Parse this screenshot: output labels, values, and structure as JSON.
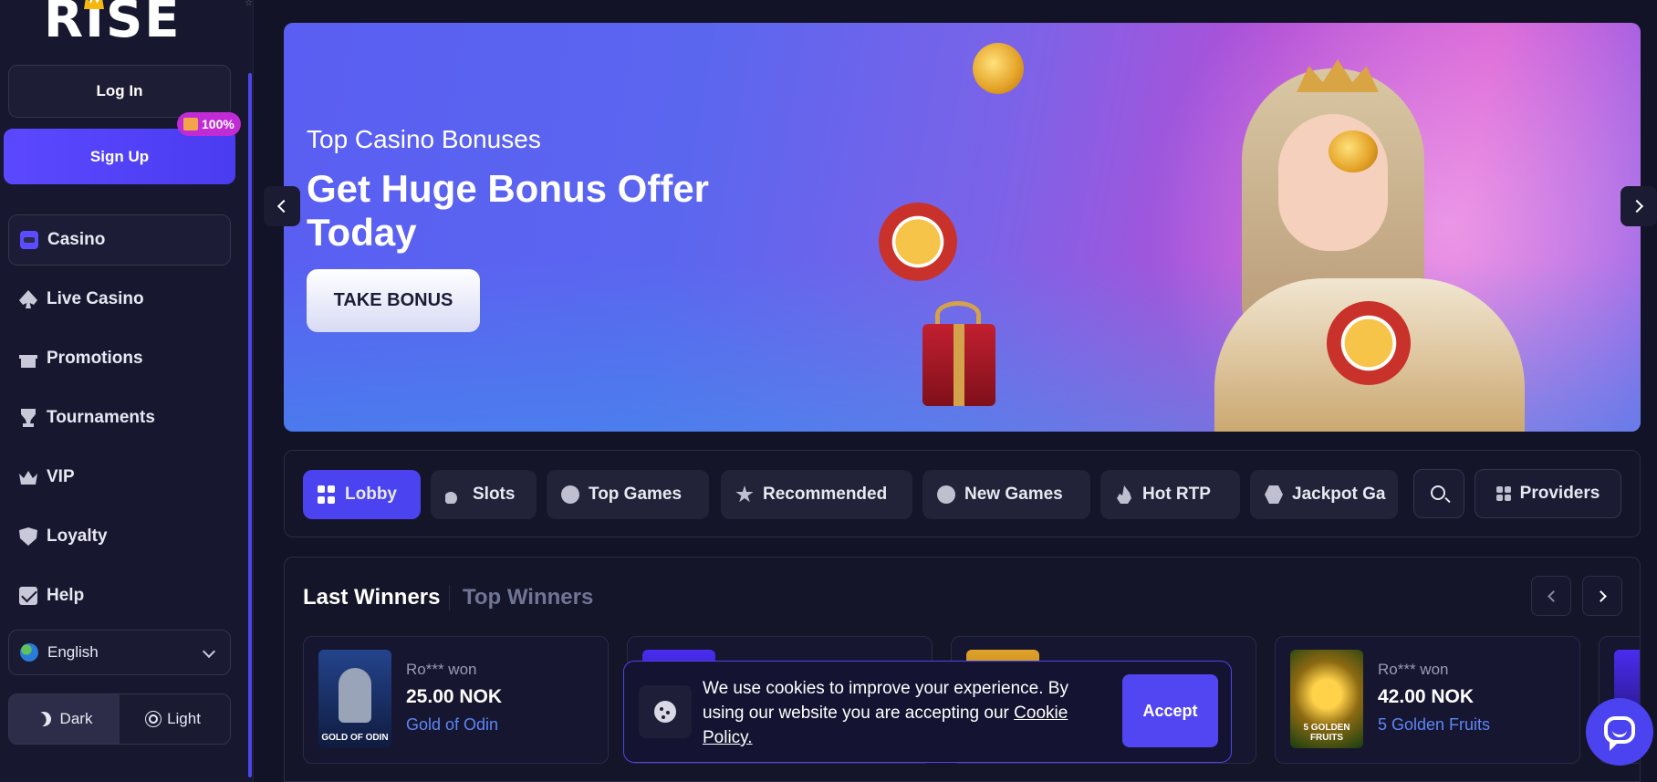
{
  "brand": {
    "logo_text": "RISE"
  },
  "auth": {
    "login_label": "Log In",
    "signup_label": "Sign Up",
    "signup_badge": "100%"
  },
  "sidebar": {
    "items": [
      {
        "label": "Casino",
        "icon": "casino-icon"
      },
      {
        "label": "Live Casino",
        "icon": "spade-icon"
      },
      {
        "label": "Promotions",
        "icon": "gift-icon"
      },
      {
        "label": "Tournaments",
        "icon": "trophy-icon"
      },
      {
        "label": "VIP",
        "icon": "crown-icon"
      },
      {
        "label": "Loyalty",
        "icon": "shield-icon"
      },
      {
        "label": "Help",
        "icon": "mail-icon"
      }
    ],
    "active_item": "Casino",
    "language": "English",
    "theme": {
      "dark_label": "Dark",
      "light_label": "Light",
      "selected": "Dark"
    }
  },
  "banner": {
    "subtitle": "Top Casino Bonuses",
    "title": "Get Huge Bonus Offer Today",
    "cta_label": "TAKE BONUS"
  },
  "categories": {
    "tabs": [
      {
        "label": "Lobby",
        "icon": "grid-icon"
      },
      {
        "label": "Slots",
        "icon": "cherry-icon"
      },
      {
        "label": "Top Games",
        "icon": "medal-icon"
      },
      {
        "label": "Recommended",
        "icon": "star-icon"
      },
      {
        "label": "New Games",
        "icon": "new-badge-icon"
      },
      {
        "label": "Hot RTP",
        "icon": "fire-icon"
      },
      {
        "label": "Jackpot Ga",
        "icon": "hexagon-icon"
      }
    ],
    "active_tab": "Lobby",
    "providers_label": "Providers"
  },
  "winners": {
    "tab_last": "Last Winners",
    "tab_top": "Top Winners",
    "cards": [
      {
        "user": "Ro*** won",
        "amount": "25.00 NOK",
        "game": "Gold of Odin",
        "thumb_label": "GOLD OF ODIN"
      },
      {
        "user": "",
        "amount": "",
        "game": "",
        "thumb_label": ""
      },
      {
        "user": "",
        "amount": "",
        "game": "",
        "thumb_label": ""
      },
      {
        "user": "Ro*** won",
        "amount": "42.00 NOK",
        "game": "5 Golden Fruits",
        "thumb_label": "5 GOLDEN FRUITS"
      }
    ]
  },
  "cookie": {
    "text": "We use cookies to improve your experience. By using our website you are accepting our ",
    "link": "Cookie Policy.",
    "accept_label": "Accept"
  },
  "colors": {
    "accent": "#4b43ef",
    "background": "#131327",
    "link": "#5e86f5",
    "badge": "#c02bd6"
  }
}
